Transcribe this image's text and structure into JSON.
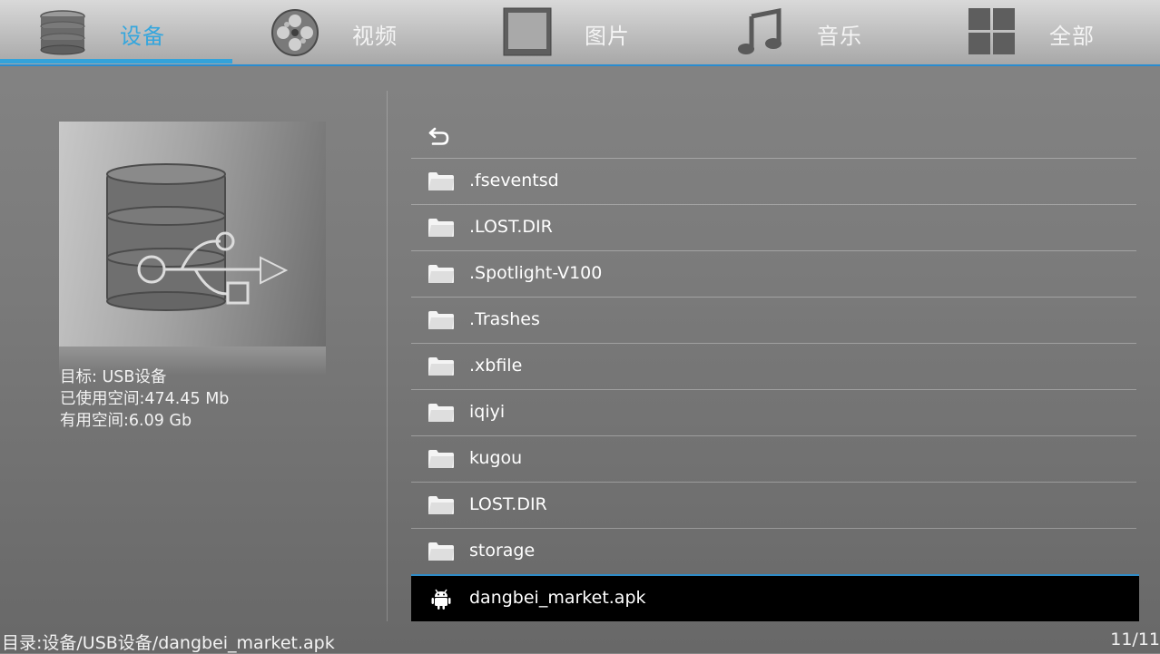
{
  "nav": {
    "tabs": [
      {
        "label": "设备",
        "icon": "database-icon",
        "active": true
      },
      {
        "label": "视频",
        "icon": "film-reel-icon",
        "active": false
      },
      {
        "label": "图片",
        "icon": "picture-frame-icon",
        "active": false
      },
      {
        "label": "音乐",
        "icon": "music-note-icon",
        "active": false
      },
      {
        "label": "全部",
        "icon": "grid-icon",
        "active": false
      }
    ],
    "accent_color": "#33a3da"
  },
  "device": {
    "icon": "usb-drive-icon",
    "target": "目标: USB设备",
    "used_space": "已使用空间:474.45 Mb",
    "free_space": "有用空间:6.09 Gb"
  },
  "files": {
    "back_icon": "back-arrow-icon",
    "items": [
      {
        "name": ".fseventsd",
        "type": "folder"
      },
      {
        "name": ".LOST.DIR",
        "type": "folder"
      },
      {
        "name": ".Spotlight-V100",
        "type": "folder"
      },
      {
        "name": ".Trashes",
        "type": "folder"
      },
      {
        "name": ".xbfile",
        "type": "folder"
      },
      {
        "name": "iqiyi",
        "type": "folder"
      },
      {
        "name": "kugou",
        "type": "folder"
      },
      {
        "name": "LOST.DIR",
        "type": "folder"
      },
      {
        "name": "storage",
        "type": "folder"
      },
      {
        "name": "dangbei_market.apk",
        "type": "apk",
        "selected": true
      }
    ]
  },
  "status": {
    "path": "目录:设备/USB设备/dangbei_market.apk",
    "position": "11/11"
  }
}
